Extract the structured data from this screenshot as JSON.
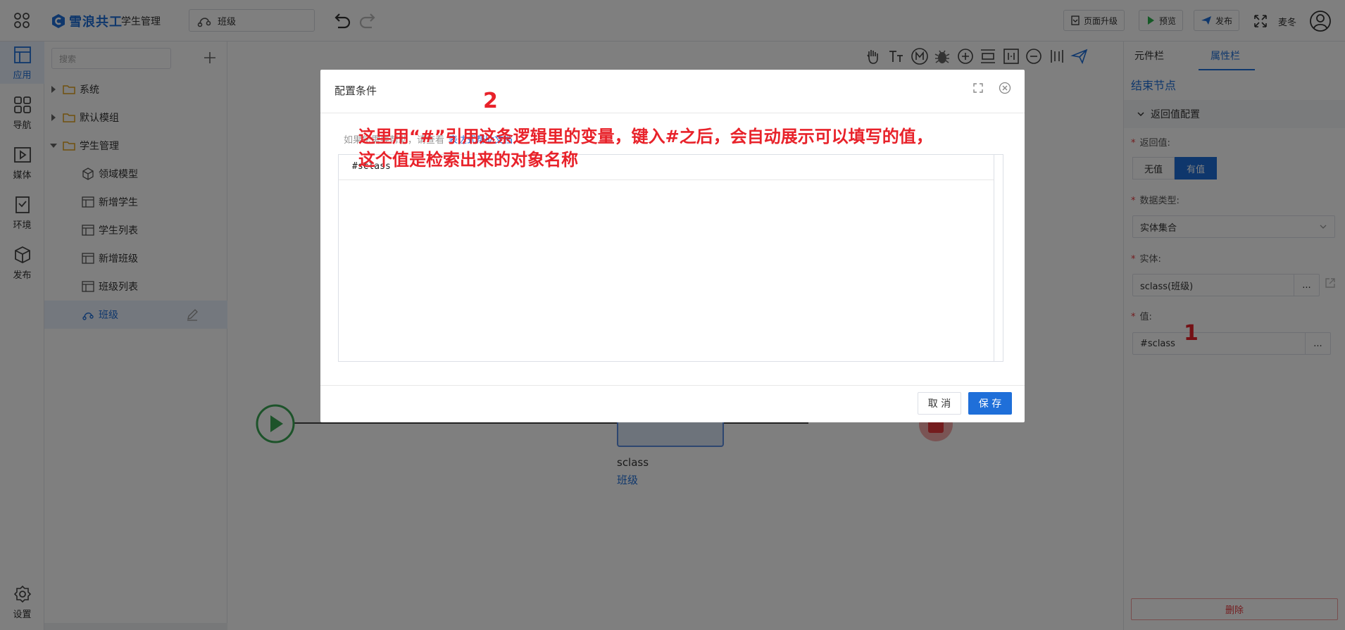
{
  "header": {
    "brand": "雪浪共工",
    "app_name": "学生管理",
    "logic_name": "班级",
    "buttons": {
      "upgrade": "页面升级",
      "preview": "预览",
      "publish": "发布"
    },
    "user_name": "麦冬"
  },
  "rail": {
    "items": [
      "应用",
      "导航",
      "媒体",
      "环境",
      "发布"
    ],
    "settings": "设置"
  },
  "tree": {
    "search_placeholder": "搜索",
    "folders": [
      "系统",
      "默认模组",
      "学生管理"
    ],
    "children": [
      "领域模型",
      "新增学生",
      "学生列表",
      "新增班级",
      "班级列表",
      "班级"
    ]
  },
  "canvas": {
    "node_name": "sclass",
    "node_sub": "班级"
  },
  "props": {
    "tabs": [
      "元件栏",
      "属性栏"
    ],
    "title": "结束节点",
    "section": "返回值配置",
    "return_label": "返回值:",
    "return_options": [
      "无值",
      "有值"
    ],
    "type_label": "数据类型:",
    "type_value": "实体集合",
    "entity_label": "实体:",
    "entity_value": "sclass(班级)",
    "value_label": "值:",
    "value_value": "#sclass",
    "dots": "...",
    "annotation": "1",
    "delete": "删除"
  },
  "dialog": {
    "title": "配置条件",
    "help_text": "如果您需要帮助，请查看",
    "help_link": "表达式帮助文档",
    "code": "#sclass",
    "annotation_number": "2",
    "annotation_line1": "这里用“#”引用这条逻辑里的变量，键入#之后，会自动展示可以填写的值，",
    "annotation_line2": "这个值是检索出来的对象名称",
    "cancel": "取 消",
    "save": "保 存"
  },
  "colors": {
    "accent": "#1f6fd9",
    "annotation": "#e8222a",
    "start": "#3aa654",
    "end": "#e8383d"
  },
  "icons": [
    "apps-icon",
    "undo-icon",
    "redo-icon",
    "fullscreen-icon",
    "user-icon",
    "app-icon",
    "nav-icon",
    "media-icon",
    "env-icon",
    "publish-icon",
    "settings-icon",
    "folder-icon",
    "cube-icon",
    "table-icon",
    "logic-icon",
    "edit-icon",
    "hand-icon",
    "text-size-icon",
    "m-icon",
    "bug-icon",
    "zoom-in-icon",
    "align-icon",
    "grid-icon",
    "zoom-out-icon",
    "columns-icon",
    "send-icon",
    "maximize-icon",
    "close-icon",
    "chevron-down-icon",
    "external-link-icon"
  ]
}
